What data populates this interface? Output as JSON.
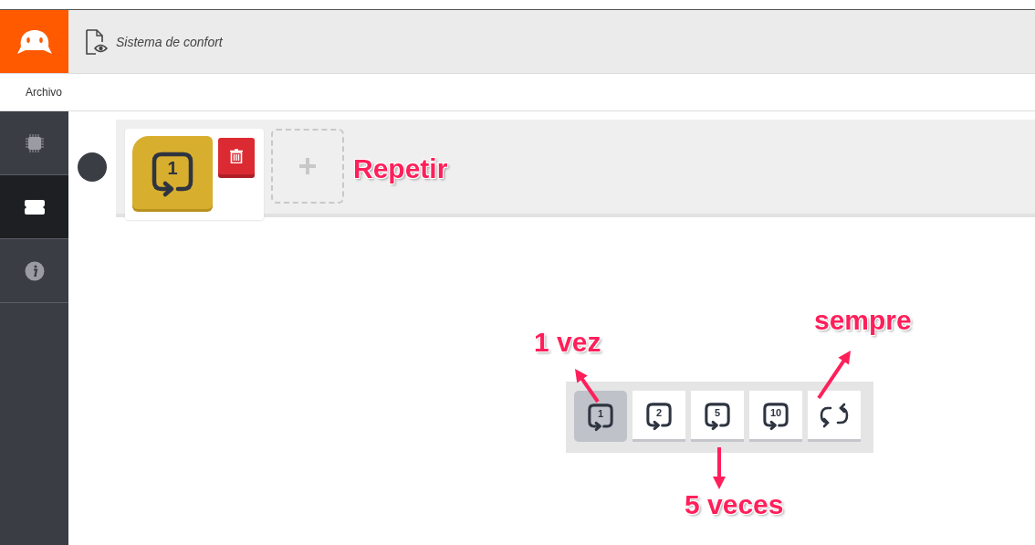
{
  "header": {
    "title": "Sistema de confort"
  },
  "menu": [
    {
      "label": "Archivo"
    }
  ],
  "sidebar": {
    "items": [
      {
        "kind": "chip",
        "selected": false
      },
      {
        "kind": "block",
        "selected": true
      },
      {
        "kind": "info",
        "selected": false
      }
    ]
  },
  "program": {
    "block": {
      "count": "1"
    }
  },
  "options": [
    {
      "kind": "count",
      "count": "1",
      "selected": true
    },
    {
      "kind": "count",
      "count": "2",
      "selected": false
    },
    {
      "kind": "count",
      "count": "5",
      "selected": false
    },
    {
      "kind": "count",
      "count": "10",
      "selected": false
    },
    {
      "kind": "forever",
      "selected": false
    }
  ],
  "annotations": [
    {
      "text": "Repetir"
    },
    {
      "text": "1 vez"
    },
    {
      "text": "sempre"
    },
    {
      "text": "5 veces"
    }
  ]
}
